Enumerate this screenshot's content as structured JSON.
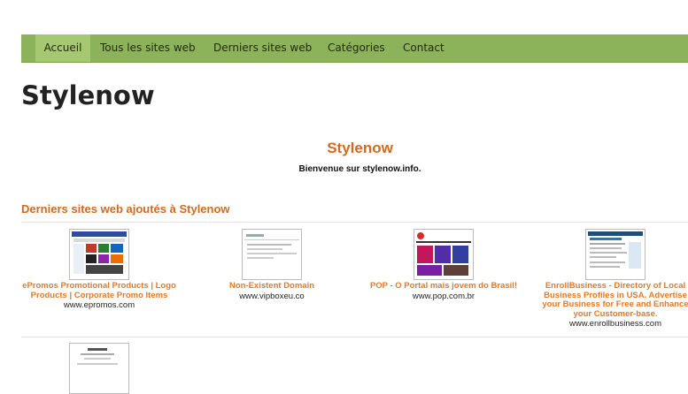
{
  "nav": {
    "items": [
      {
        "label": "Accueil",
        "active": true
      },
      {
        "label": "Tous les sites web"
      },
      {
        "label": "Derniers sites web"
      },
      {
        "label": "Catégories"
      },
      {
        "label": "Contact"
      }
    ]
  },
  "site": {
    "title": "Stylenow"
  },
  "hero": {
    "title": "Stylenow",
    "subtitle": "Bienvenue sur stylenow.info."
  },
  "section": {
    "title": "Derniers sites web ajoutés à Stylenow"
  },
  "sites": [
    {
      "title": "ePromos Promotional Products | Logo Products | Corporate Promo Items",
      "url": "www.epromos.com"
    },
    {
      "title": "Non-Existent Domain",
      "url": "www.vipboxeu.co"
    },
    {
      "title": "POP - O Portal mais jovem do Brasil!",
      "url": "www.pop.com.br"
    },
    {
      "title": "EnrollBusiness - Directory of Local Business Profiles in USA. Advertise your Business for Free and Enhance your Customer-base.",
      "url": "www.enrollbusiness.com"
    }
  ],
  "colors": {
    "nav_bg": "#8db35a",
    "nav_active": "#a6c870",
    "accent": "#d2691e"
  }
}
